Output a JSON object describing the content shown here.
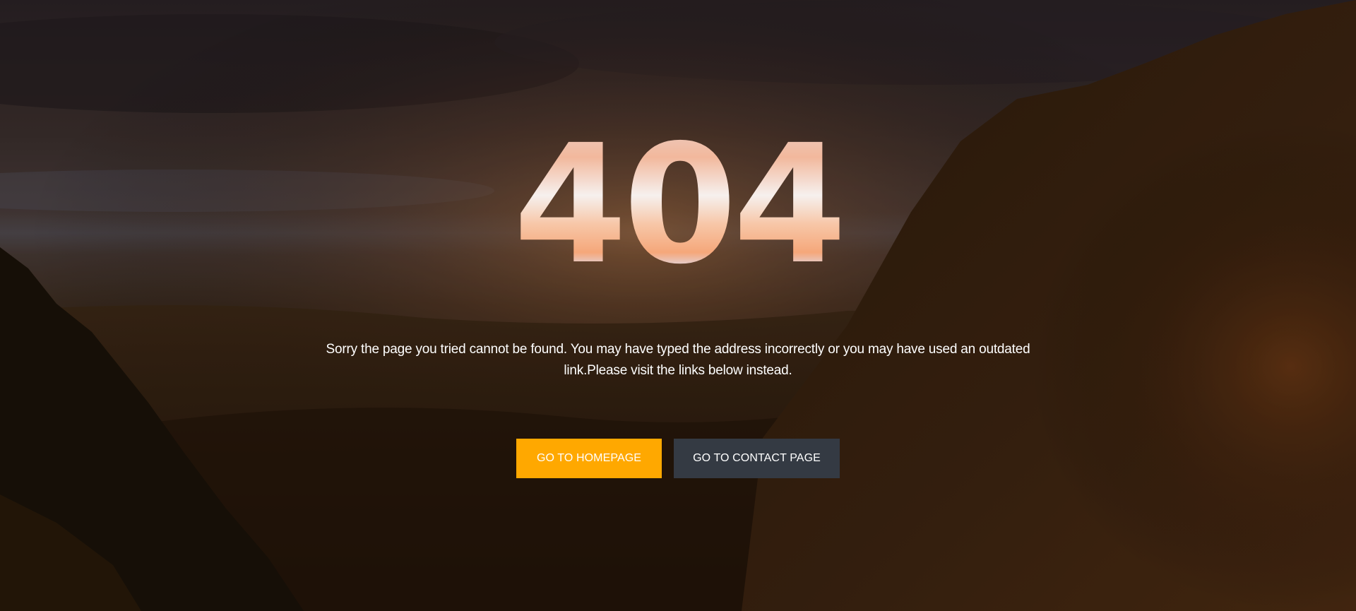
{
  "error": {
    "code": "404",
    "message": "Sorry the page you tried cannot be found. You may have typed the address incorrectly or you may have used an outdated link.Please visit the links below instead."
  },
  "actions": {
    "home_label": "GO TO HOMEPAGE",
    "contact_label": "GO TO CONTACT PAGE"
  },
  "colors": {
    "primary_button": "#ffa800",
    "secondary_button": "#343a43",
    "text": "#ffffff"
  }
}
